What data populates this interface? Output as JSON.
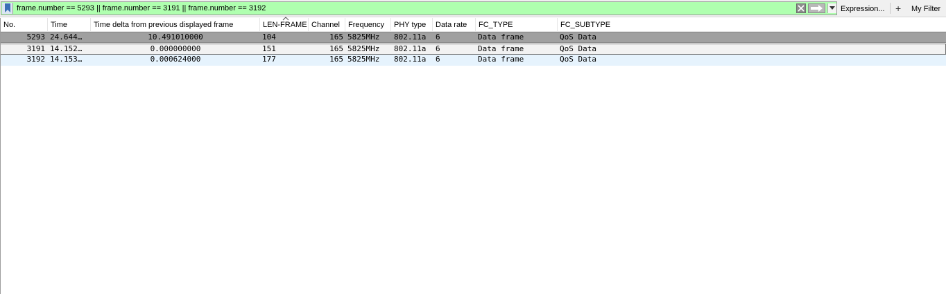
{
  "filter": {
    "expression": "frame.number == 5293 || frame.number == 3191 || frame.number == 3192",
    "expression_button": "Expression...",
    "add_button": "+",
    "my_filter_button": "My Filter"
  },
  "columns": [
    "No.",
    "Time",
    "Time delta from previous displayed frame",
    "LEN-FRAME",
    "Channel",
    "Frequency",
    "PHY type",
    "Data rate",
    "FC_TYPE",
    "FC_SUBTYPE"
  ],
  "rows": [
    [
      "5293",
      "24.644…",
      "10.491010000",
      "104",
      "165",
      "5825MHz",
      "802.11a",
      "6",
      "Data frame",
      "QoS Data"
    ],
    [
      "3191",
      "14.152…",
      "0.000000000",
      "151",
      "165",
      "5825MHz",
      "802.11a",
      "6",
      "Data frame",
      "QoS Data"
    ],
    [
      "3192",
      "14.153…",
      "0.000624000",
      "177",
      "165",
      "5825MHz",
      "802.11a",
      "6",
      "Data frame",
      "QoS Data"
    ]
  ],
  "colors": {
    "filter_valid_bg": "#afffaf",
    "selected_row_bg": "#a0a0a0",
    "row_alt_bg": "#e6f3fd"
  }
}
